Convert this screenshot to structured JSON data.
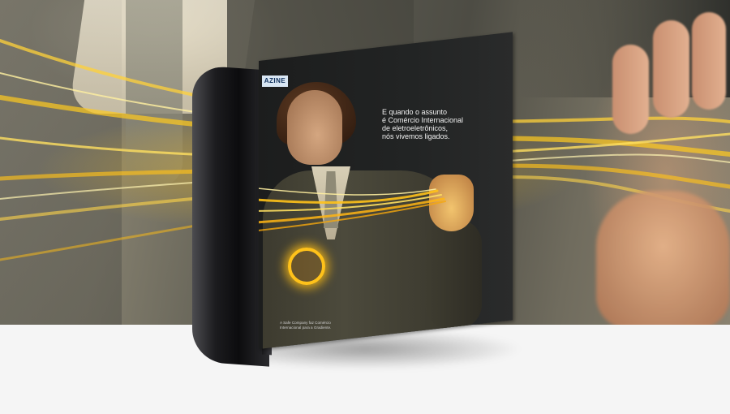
{
  "magazine": {
    "logo_text": "AZINE",
    "headline_lines": [
      "E quando o assunto",
      "é Comércio Internacional",
      "de eletroeletrônicos,",
      "nós vivemos ligados."
    ],
    "footnote_lines": [
      "A Safe Company faz Comércio",
      "Internacional para a Gradiente."
    ]
  },
  "colors": {
    "glow": "#ffc21a",
    "page": "#222424",
    "floor": "#f5f5f5"
  }
}
